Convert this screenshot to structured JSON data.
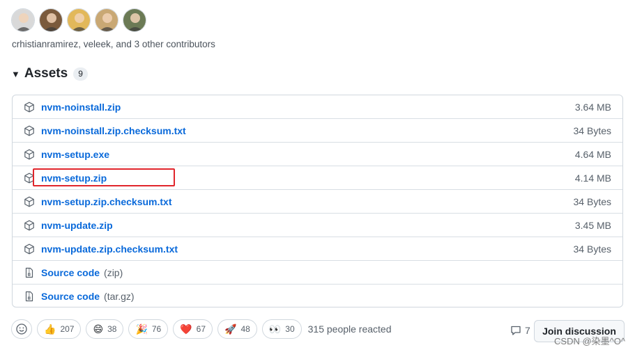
{
  "contributors": {
    "avatars": [
      {
        "name": "avatar-1",
        "color": "#d9d9d9"
      },
      {
        "name": "avatar-2",
        "color": "#7a5a3c"
      },
      {
        "name": "avatar-3",
        "color": "#e2b85a"
      },
      {
        "name": "avatar-4",
        "color": "#c9a874"
      },
      {
        "name": "avatar-5",
        "color": "#6b7a55"
      }
    ],
    "text": "crhistianramirez, veleek, and 3 other contributors"
  },
  "assets": {
    "title": "Assets",
    "count": "9",
    "items": [
      {
        "name": "nvm-noinstall.zip",
        "size": "3.64 MB",
        "icon": "package-icon"
      },
      {
        "name": "nvm-noinstall.zip.checksum.txt",
        "size": "34 Bytes",
        "icon": "package-icon"
      },
      {
        "name": "nvm-setup.exe",
        "size": "4.64 MB",
        "icon": "package-icon"
      },
      {
        "name": "nvm-setup.zip",
        "size": "4.14 MB",
        "icon": "package-icon"
      },
      {
        "name": "nvm-setup.zip.checksum.txt",
        "size": "34 Bytes",
        "icon": "package-icon"
      },
      {
        "name": "nvm-update.zip",
        "size": "3.45 MB",
        "icon": "package-icon"
      },
      {
        "name": "nvm-update.zip.checksum.txt",
        "size": "34 Bytes",
        "icon": "package-icon"
      },
      {
        "name": "Source code",
        "format": "(zip)",
        "size": "",
        "icon": "file-zip-icon"
      },
      {
        "name": "Source code",
        "format": "(tar.gz)",
        "size": "",
        "icon": "file-zip-icon"
      }
    ]
  },
  "reactions": {
    "items": [
      {
        "emoji": "👍",
        "count": "207",
        "name": "thumbs-up"
      },
      {
        "emoji": "😄",
        "count": "38",
        "name": "laugh"
      },
      {
        "emoji": "🎉",
        "count": "76",
        "name": "hooray"
      },
      {
        "emoji": "❤️",
        "count": "67",
        "name": "heart"
      },
      {
        "emoji": "🚀",
        "count": "48",
        "name": "rocket"
      },
      {
        "emoji": "👀",
        "count": "30",
        "name": "eyes"
      }
    ],
    "summary": "315 people reacted"
  },
  "discussion": {
    "comment_count": "7",
    "join_label": "Join discussion"
  },
  "watermark": "CSDN @染墨^O^",
  "colors": {
    "link": "#0969da",
    "highlight": "#e0252b"
  }
}
